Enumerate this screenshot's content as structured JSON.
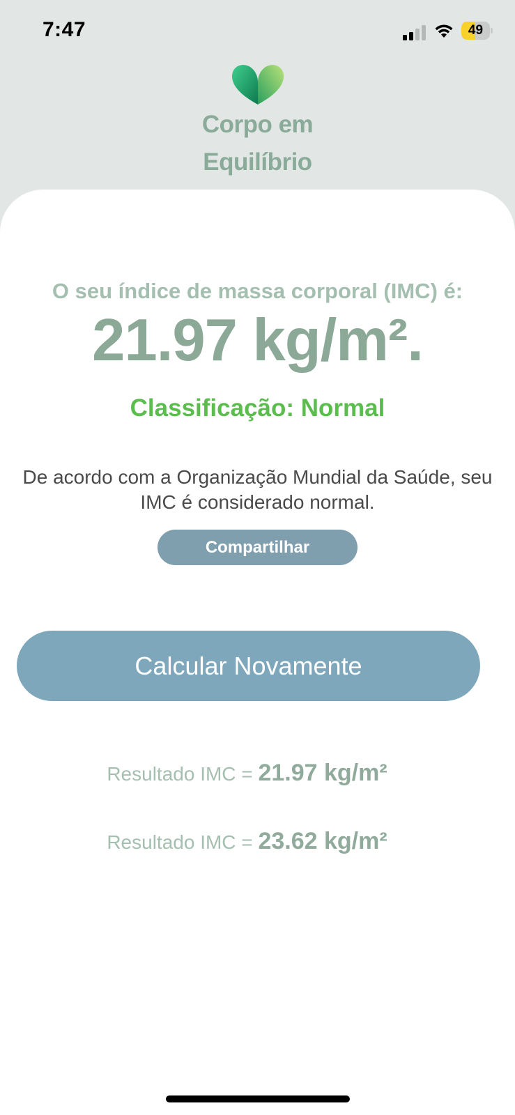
{
  "status_bar": {
    "time": "7:47",
    "battery_percent": "49",
    "battery_color": "#f8d12a"
  },
  "brand": {
    "line1": "Corpo em",
    "line2": "Equilíbrio",
    "logo_icon": "leaf-heart-icon",
    "color": "#8aab99"
  },
  "result": {
    "intro": "O seu índice de massa corporal (IMC) é:",
    "value": "21.97 kg/m².",
    "classification": "Classificação: Normal",
    "classification_color": "#5cbd4f",
    "description": "De acordo com a Organização Mundial da Saúde, seu IMC é considerado normal."
  },
  "actions": {
    "share_label": "Compartilhar",
    "recalculate_label": "Calcular Novamente"
  },
  "history": [
    {
      "label": "Resultado IMC = ",
      "value": "21.97 kg/m²"
    },
    {
      "label": "Resultado IMC = ",
      "value": "23.62 kg/m²"
    }
  ]
}
